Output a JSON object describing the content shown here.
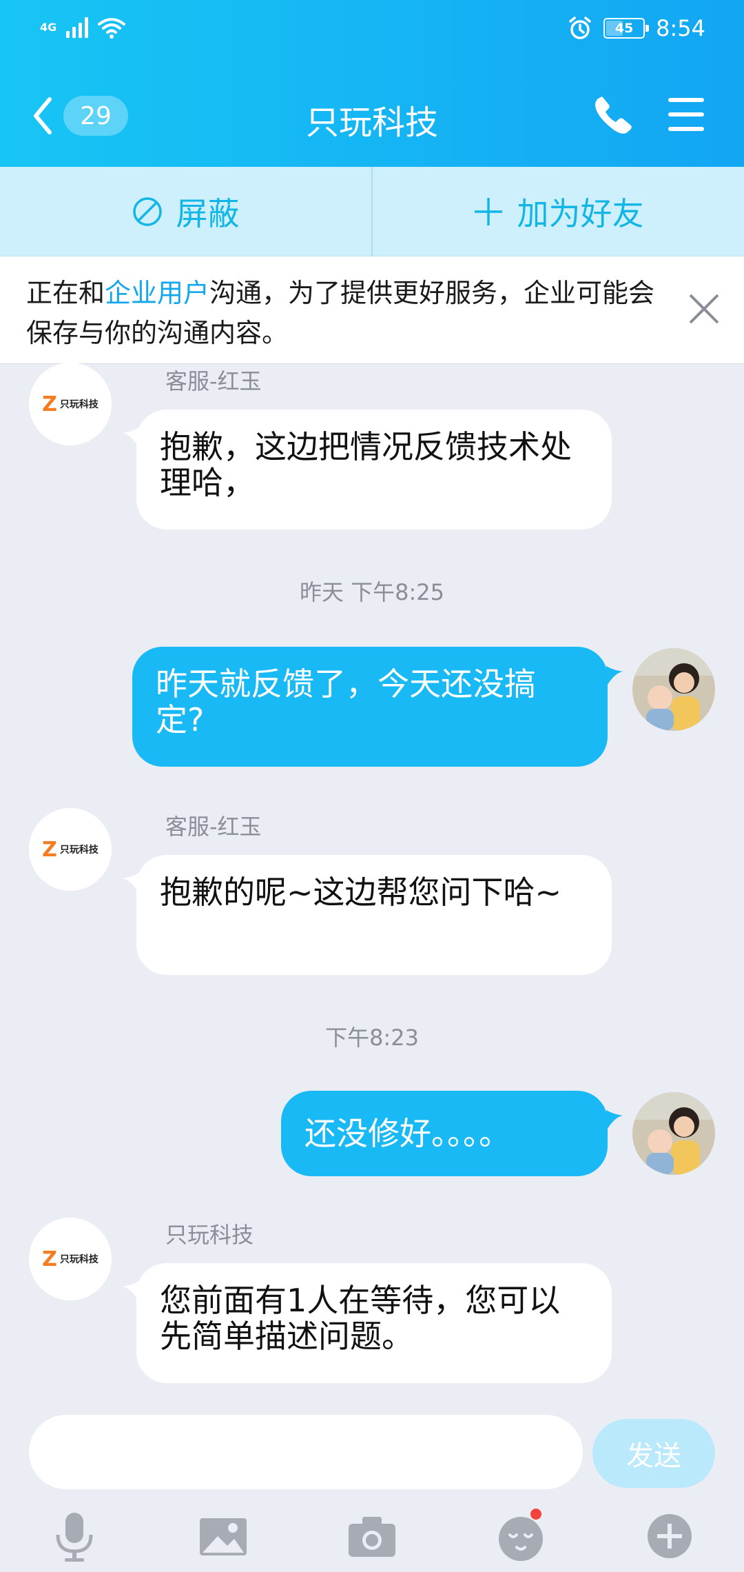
{
  "status": {
    "network": "4G",
    "battery": "45",
    "battery_level": 0.45,
    "time": "8:54"
  },
  "header": {
    "title": "只玩科技",
    "back_badge": "29",
    "icons": [
      "chevron-left-icon",
      "phone-icon",
      "menu-icon"
    ]
  },
  "actions": {
    "block_label": "屏蔽",
    "add_friend_label": "加为好友"
  },
  "notice": {
    "text_before": "正在和",
    "highlight": "企业用户",
    "text_after": "沟通，为了提供更好服务，企业可能会保存与你的沟通内容。"
  },
  "messages": [
    {
      "type": "incoming",
      "sender": "客服-红玉",
      "text": "抱歉，这边把情况反馈技术处理哈，",
      "avatar_logo_text": "只玩科技"
    },
    {
      "type": "time",
      "text": "昨天 下午8:25"
    },
    {
      "type": "outgoing",
      "text": "昨天就反馈了，今天还没搞定?"
    },
    {
      "type": "incoming",
      "sender": "客服-红玉",
      "text": "抱歉的呢~这边帮您问下哈~",
      "avatar_logo_text": "只玩科技"
    },
    {
      "type": "time",
      "text": "下午8:23"
    },
    {
      "type": "outgoing",
      "text": "还没修好。。。。"
    },
    {
      "type": "incoming",
      "sender": "只玩科技",
      "text": "您前面有1人在等待，您可以先简单描述问题。",
      "avatar_logo_text": "只玩科技"
    }
  ],
  "input": {
    "placeholder": "",
    "send_label": "发送"
  },
  "toolbar": [
    "microphone-icon",
    "image-icon",
    "camera-icon",
    "emoji-icon",
    "plus-icon"
  ],
  "colors": {
    "header_start": "#17c5f4",
    "header_end": "#13a6f3",
    "outgoing_bubble": "#19b9f6",
    "action_bar": "#cdf0fc",
    "accent": "#12b6e6",
    "background": "#eaedf4"
  }
}
